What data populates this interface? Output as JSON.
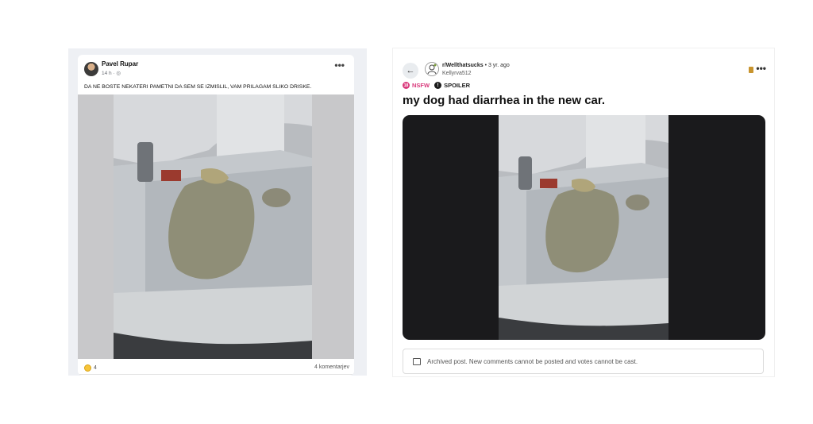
{
  "facebook_post": {
    "author": "Pavel Rupar",
    "time": "14 h · ◎",
    "more": "•••",
    "text": "DA NE BOSTE NEKATERI PAMETNI DA SEM SE IZMISLIL, VAM PRILAGAM SLIKO DRISKE.",
    "reaction_count": "4",
    "comments": "4 komentarjev"
  },
  "reddit_post": {
    "back": "←",
    "subreddit": "r/Wellthatsucks",
    "age": " • 3 yr. ago",
    "user": "Kellyrva512",
    "more": "•••",
    "tags": {
      "nsfw": "NSFW",
      "nsfw_icon": "18",
      "spoiler": "SPOILER",
      "spoiler_icon": "!"
    },
    "title": "my dog had diarrhea in the new car.",
    "archived_text": "Archived post. New comments cannot be posted and votes cannot be cast."
  },
  "colors": {
    "nsfw": "#d93a7c",
    "fb_bg": "#eef0f4",
    "media_bg": "#1a1a1c"
  }
}
